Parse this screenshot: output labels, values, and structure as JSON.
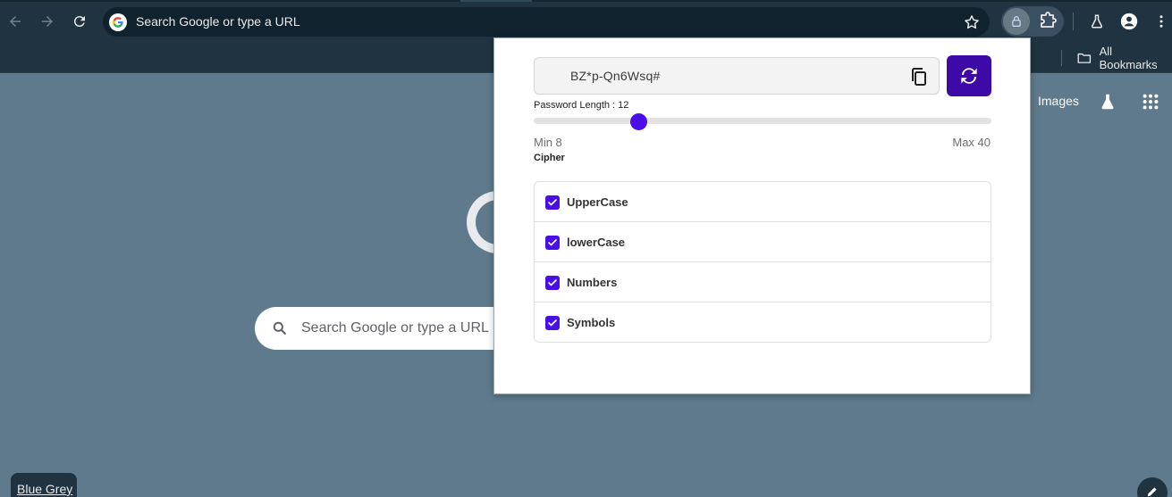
{
  "browser": {
    "omnibox_placeholder": "Search Google or type a URL",
    "bookmarks_all": "All Bookmarks"
  },
  "ntp": {
    "images_link": "Images",
    "search_placeholder": "Search Google or type a URL",
    "theme_name": "Blue Grey"
  },
  "popup": {
    "password": "BZ*p-Qn6Wsq#",
    "length_label": "Password Length : 12",
    "length_value": 12,
    "length_min": 8,
    "length_max": 40,
    "min_label": "Min 8",
    "max_label": "Max 40",
    "cipher_label": "Cipher",
    "options": [
      {
        "label": "UpperCase",
        "checked": true
      },
      {
        "label": "lowerCase",
        "checked": true
      },
      {
        "label": "Numbers",
        "checked": true
      },
      {
        "label": "Symbols",
        "checked": true
      }
    ],
    "accent": "#4a0ee6",
    "button_color": "#3d0aa8"
  },
  "icons": [
    "back-icon",
    "forward-icon",
    "reload-icon",
    "google-icon",
    "star-icon",
    "lock-icon",
    "puzzle-icon",
    "labs-icon",
    "profile-icon",
    "menu-icon",
    "folder-icon",
    "apps-icon",
    "search-icon",
    "copy-icon",
    "refresh-icon",
    "checkmark-icon",
    "pencil-icon"
  ]
}
